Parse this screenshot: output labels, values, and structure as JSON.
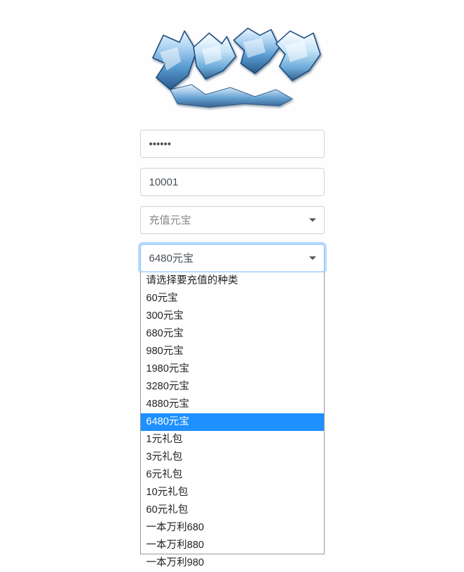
{
  "logo": {
    "name": "game-logo"
  },
  "password": {
    "value": "••••••"
  },
  "server_id": {
    "value": "10001"
  },
  "recharge_type": {
    "selected": "充值元宝"
  },
  "amount_select": {
    "selected": "6480元宝",
    "options": [
      "请选择要充值的种类",
      "60元宝",
      "300元宝",
      "680元宝",
      "980元宝",
      "1980元宝",
      "3280元宝",
      "4880元宝",
      "6480元宝",
      "1元礼包",
      "3元礼包",
      "6元礼包",
      "10元礼包",
      "60元礼包",
      "一本万利680",
      "一本万利880",
      "一本万利980"
    ],
    "selected_index": 8
  }
}
